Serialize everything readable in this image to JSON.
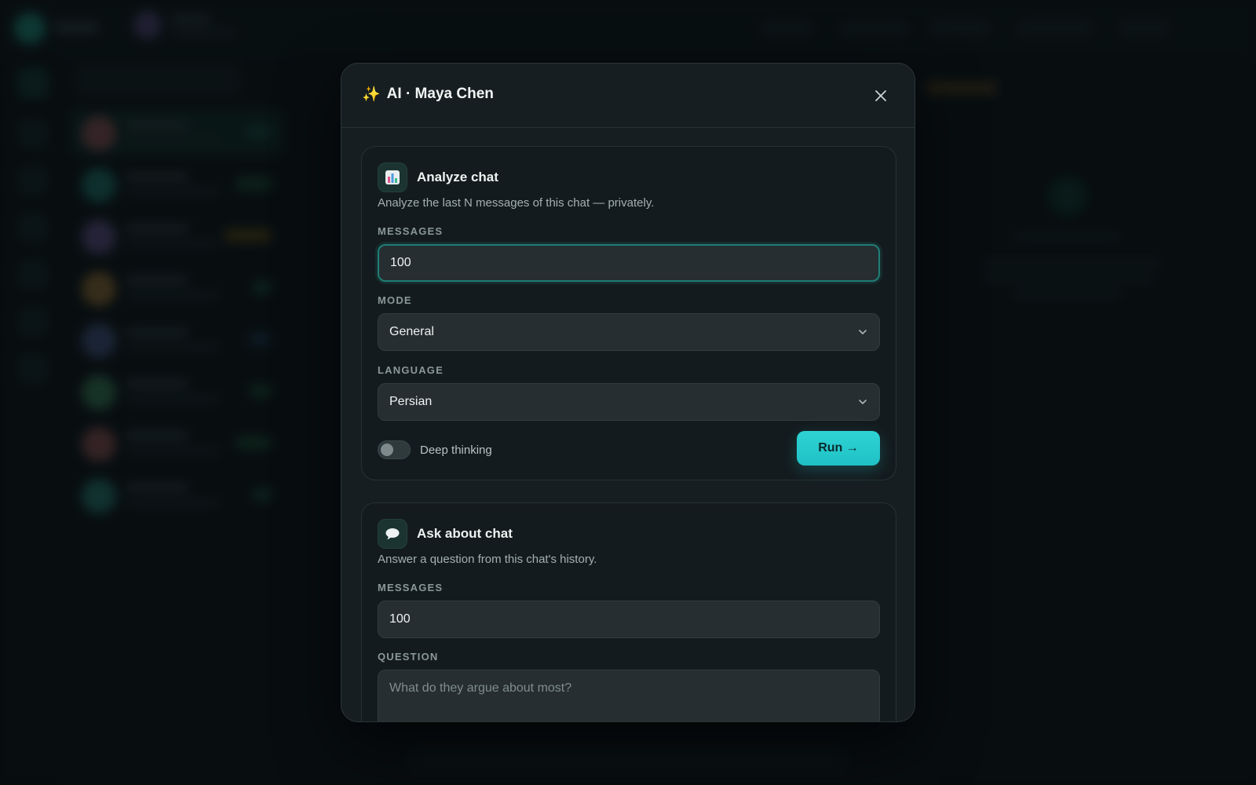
{
  "modal": {
    "title": "AI · Maya Chen",
    "title_icon": "sparkle-icon",
    "close_icon": "close-icon"
  },
  "analyze": {
    "icon": "bar-chart-icon",
    "title": "Analyze chat",
    "description": "Analyze the last N messages of this chat — privately.",
    "messages_label": "MESSAGES",
    "messages_value": "100",
    "mode_label": "MODE",
    "mode_value": "General",
    "language_label": "LANGUAGE",
    "language_value": "Persian",
    "deep_thinking_label": "Deep thinking",
    "deep_thinking_on": false,
    "run_label": "Run →"
  },
  "ask": {
    "icon": "speech-bubble-icon",
    "title": "Ask about chat",
    "description": "Answer a question from this chat's history.",
    "messages_label": "MESSAGES",
    "messages_value": "100",
    "question_label": "QUESTION",
    "question_placeholder": "What do they argue about most?"
  },
  "colors": {
    "accent": "#1fc1c6",
    "modal_bg": "#161e21",
    "card_bg": "#141b1e",
    "input_bg": "#262e31",
    "focus_border": "#1f7e76"
  }
}
